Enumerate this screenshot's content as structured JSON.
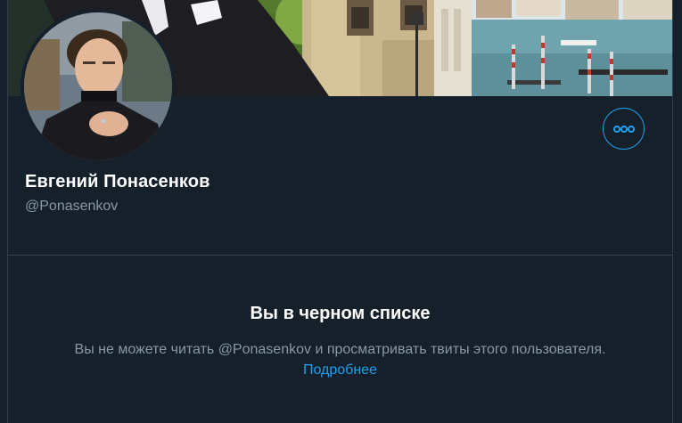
{
  "profile": {
    "display_name": "Евгений Понасенков",
    "handle": "@Ponasenkov",
    "more_icon": "more-horizontal-icon"
  },
  "blocked": {
    "title": "Вы в черном списке",
    "message": "Вы не можете читать @Ponasenkov и просматривать твиты этого пользователя.",
    "learn_more": "Подробнее"
  },
  "colors": {
    "background": "#15202b",
    "accent": "#1da1f2",
    "secondary_text": "#8899a6"
  }
}
